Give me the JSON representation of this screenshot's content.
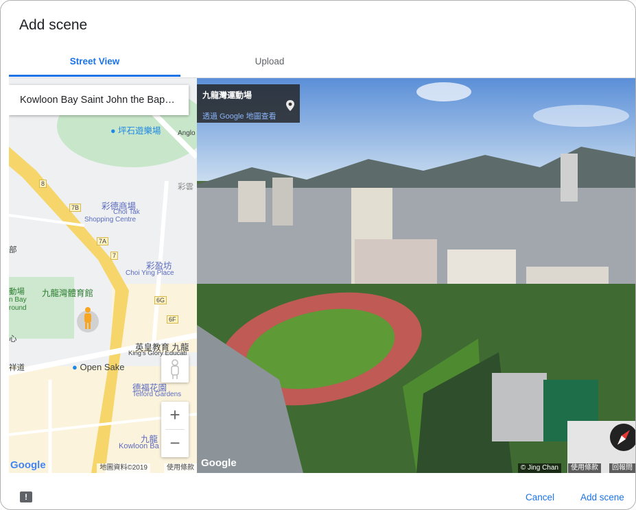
{
  "dialog": {
    "title": "Add scene"
  },
  "tabs": [
    {
      "label": "Street View"
    },
    {
      "label": "Upload"
    }
  ],
  "map": {
    "search_value": "Kowloon Bay Saint John the Bap…",
    "labels": {
      "pingshek_playground": "坪石遊樂場",
      "anglo": "Anglo",
      "choitak_zh": "彩德商場",
      "choitak_en": "Choi Tak",
      "shopping_centre": "Shopping Centre",
      "choiying_zh": "彩盈坊",
      "choiying_en": "Choi Ying Place",
      "kb_sports_ground": "九龍灣體育館",
      "kingsglory_zh": "英皇教育 九龍",
      "kingsglory_en": "King's Glory Educati",
      "open_sake": "Open Sake",
      "telford_zh": "德福花園",
      "telford_en": "Telford Gardens",
      "kowloon_bay_zh": "九龍",
      "kowloon_bay_en": "Kowloon Ba",
      "partial_1": "彩雲",
      "partial_2": "部",
      "partial_3": "動場",
      "partial_4": "n Bay",
      "partial_5": "round",
      "partial_6": "心",
      "partial_7": "祥道",
      "road_badges": [
        "8",
        "7B",
        "7A",
        "7",
        "6G",
        "6F"
      ]
    },
    "zoom_in": "+",
    "zoom_out": "−",
    "google_logo": "Google",
    "attribution": "地圖資料©2019",
    "terms": "使用條款"
  },
  "streetview": {
    "place_name": "九龍灣運動場",
    "view_in_maps": "透過 Google 地圖查看",
    "google_logo": "Google",
    "photo_credit": "© Jing Chan",
    "terms": "使用條款",
    "report": "回報問"
  },
  "footer": {
    "cancel": "Cancel",
    "add_scene": "Add scene"
  },
  "colors": {
    "accent": "#1a73e8",
    "text": "#202124",
    "muted": "#5f6368"
  }
}
